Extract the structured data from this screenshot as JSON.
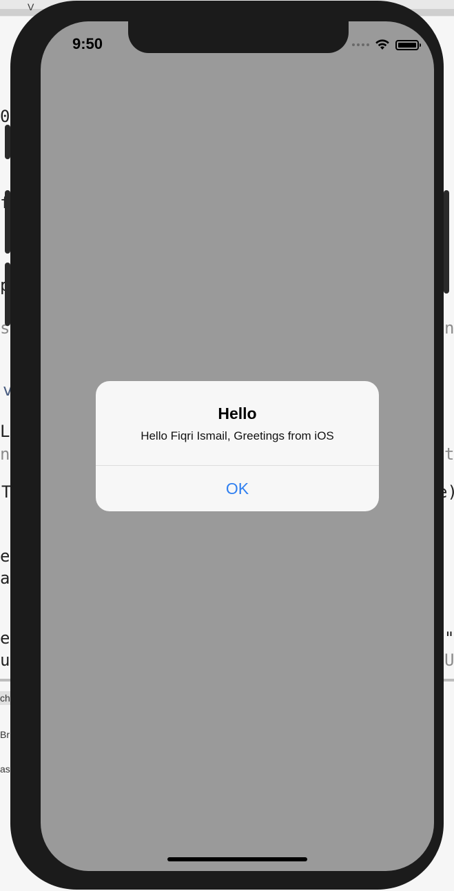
{
  "status_bar": {
    "time": "9:50"
  },
  "alert": {
    "title": "Hello",
    "message": "Hello Fiqri Ismail, Greetings from iOS",
    "ok_label": "OK"
  },
  "background_fragments": {
    "top_tab": "V",
    "lines_left": [
      "0",
      "f",
      "p",
      "s",
      "v",
      "L",
      "n",
      "T",
      "e",
      "a",
      "e",
      "u"
    ],
    "lines_right": [
      "n",
      "t",
      "e)",
      "\"",
      "U"
    ],
    "panel_tab": "ch",
    "panel_item_1": "Br",
    "panel_item_2": "as"
  },
  "colors": {
    "screen_bg": "#9a9a9a",
    "device_frame": "#1b1b1b",
    "alert_bg": "#f7f7f7",
    "accent_blue": "#2f7ff0"
  },
  "icons": [
    "wifi-icon",
    "battery-icon",
    "cellular-signal-icon"
  ]
}
